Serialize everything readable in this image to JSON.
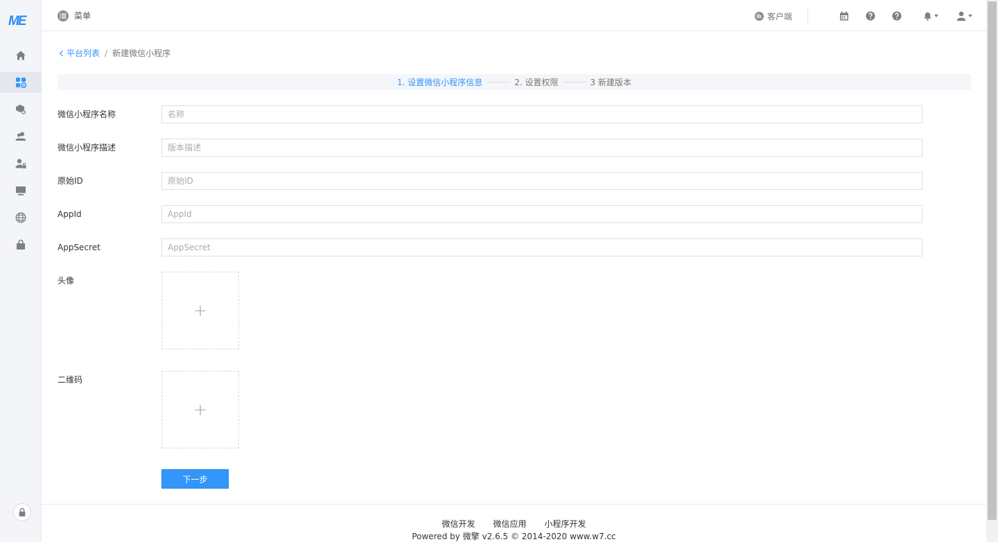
{
  "logo": "ME",
  "header": {
    "menu_label": "菜单",
    "client_label": "客户端"
  },
  "breadcrumb": {
    "back_label": "平台列表",
    "separator": "/",
    "current": "新建微信小程序"
  },
  "steps": [
    {
      "label": "1. 设置微信小程序信息",
      "active": true
    },
    {
      "label": "2. 设置权限",
      "active": false
    },
    {
      "label": "3 新建版本",
      "active": false
    }
  ],
  "form": {
    "name": {
      "label": "微信小程序名称",
      "placeholder": "名称"
    },
    "desc": {
      "label": "微信小程序描述",
      "placeholder": "版本描述"
    },
    "original_id": {
      "label": "原始ID",
      "placeholder": "原始ID"
    },
    "appid": {
      "label": "AppId",
      "placeholder": "AppId"
    },
    "appsecret": {
      "label": "AppSecret",
      "placeholder": "AppSecret"
    },
    "avatar": {
      "label": "头像"
    },
    "qrcode": {
      "label": "二维码"
    },
    "upload_plus": "+",
    "next_button": "下一步"
  },
  "footer": {
    "links": [
      "微信开发",
      "微信应用",
      "小程序开发"
    ],
    "powered": "Powered by 微擎 v2.6.5 © 2014-2020 www.w7.cc"
  },
  "colors": {
    "accent": "#3296fa",
    "sidebar_bg": "#f4f5f8",
    "icon_gray": "#7a7f88"
  }
}
